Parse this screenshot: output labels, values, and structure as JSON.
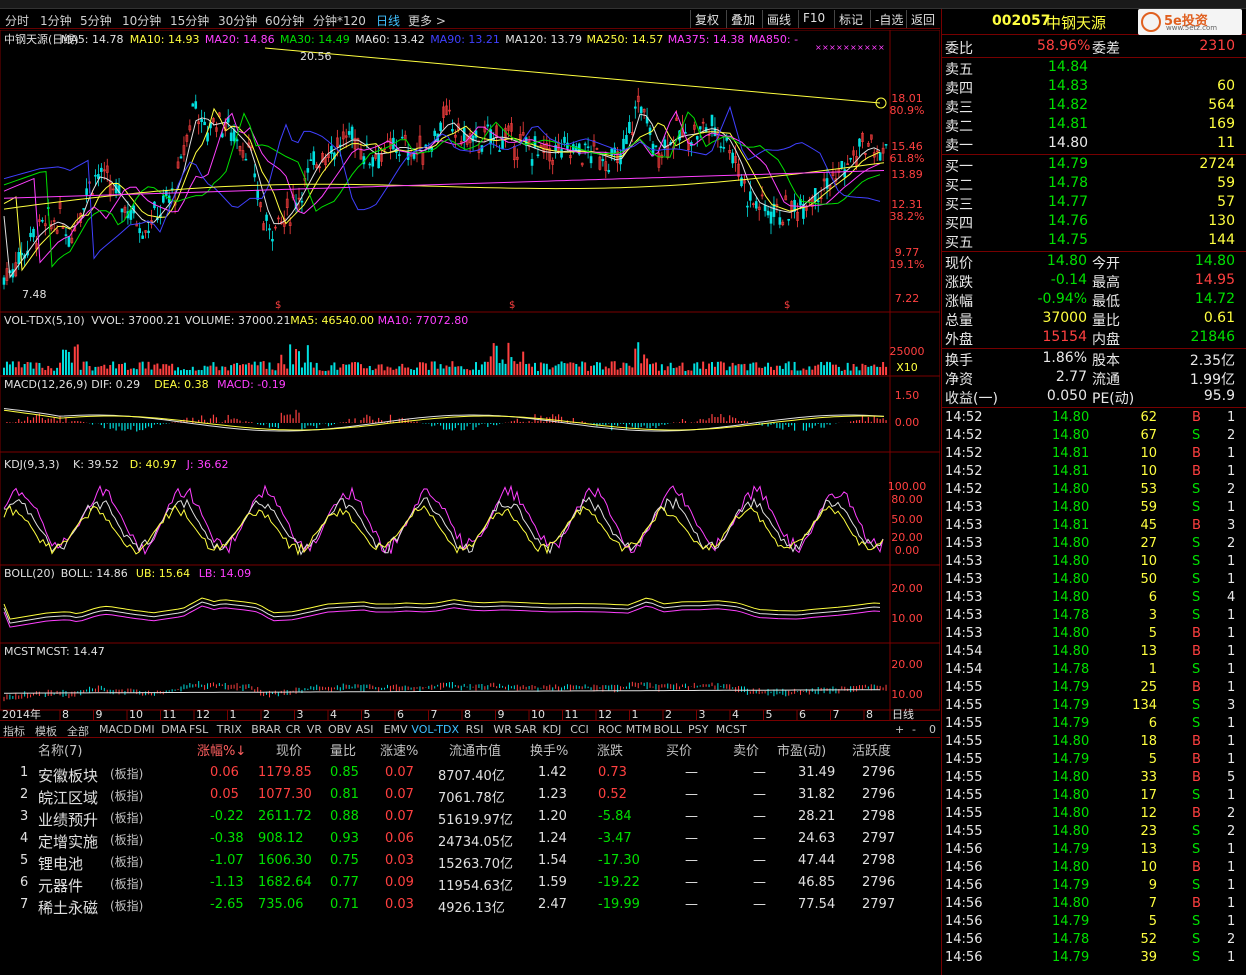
{
  "periods": [
    "分时",
    "1分钟",
    "5分钟",
    "10分钟",
    "15分钟",
    "30分钟",
    "60分钟",
    "分钟*120",
    "日线",
    "更多 >"
  ],
  "tools": [
    "复权",
    "叠加",
    "画线",
    "F10",
    "标记",
    "-自选",
    "返回"
  ],
  "stock": {
    "code": "002057",
    "name": "中钢天源",
    "logo": "5e投资",
    "logo_sub": "www.5etz.com"
  },
  "ma_legend": [
    {
      "text": "中钢天源(日线)",
      "color": "#e0e0e0"
    },
    {
      "text": "MA5: 14.78",
      "color": "#e0e0e0"
    },
    {
      "text": "MA10: 14.93",
      "color": "#ffff40"
    },
    {
      "text": "MA20: 14.86",
      "color": "#ff40ff"
    },
    {
      "text": "MA30: 14.49",
      "color": "#00e000"
    },
    {
      "text": "MA60: 13.42",
      "color": "#e0e0e0"
    },
    {
      "text": "MA90: 13.21",
      "color": "#4040ff"
    },
    {
      "text": "MA120: 13.79",
      "color": "#e0e0e0"
    },
    {
      "text": "MA250: 14.57",
      "color": "#ffff40"
    },
    {
      "text": "MA375: 14.38",
      "color": "#ff40ff"
    },
    {
      "text": "MA850: -",
      "color": "#ff40ff"
    }
  ],
  "main_axis": [
    "18.01",
    "80.9%",
    "15.46",
    "61.8%",
    "13.89",
    "12.31",
    "38.2%",
    "9.77",
    "19.1%",
    "7.22"
  ],
  "main_annotations": {
    "high": "20.56",
    "low": "7.48"
  },
  "vol_legend": [
    {
      "text": "VOL-TDX(5,10)",
      "color": "#e0e0e0"
    },
    {
      "text": "VVOL: 37000.21",
      "color": "#e0e0e0"
    },
    {
      "text": "VOLUME: 37000.21",
      "color": "#e0e0e0"
    },
    {
      "text": "MA5: 46540.00",
      "color": "#ffff40"
    },
    {
      "text": "MA10: 77072.80",
      "color": "#ff40ff"
    }
  ],
  "vol_axis": [
    "25000",
    "X10"
  ],
  "macd_legend": [
    {
      "text": "MACD(12,26,9)",
      "color": "#e0e0e0"
    },
    {
      "text": "DIF: 0.29",
      "color": "#e0e0e0"
    },
    {
      "text": "DEA: 0.38",
      "color": "#ffff40"
    },
    {
      "text": "MACD: -0.19",
      "color": "#ff40ff"
    }
  ],
  "macd_axis": [
    "1.50",
    "0.00"
  ],
  "kdj_legend": [
    {
      "text": "KDJ(9,3,3)",
      "color": "#e0e0e0"
    },
    {
      "text": "K: 39.52",
      "color": "#e0e0e0"
    },
    {
      "text": "D: 40.97",
      "color": "#ffff40"
    },
    {
      "text": "J: 36.62",
      "color": "#ff40ff"
    }
  ],
  "kdj_axis": [
    "100.00",
    "80.00",
    "50.00",
    "20.00",
    "0.00"
  ],
  "boll_legend": [
    {
      "text": "BOLL(20)",
      "color": "#e0e0e0"
    },
    {
      "text": "BOLL: 14.86",
      "color": "#e0e0e0"
    },
    {
      "text": "UB: 15.64",
      "color": "#ffff40"
    },
    {
      "text": "LB: 14.09",
      "color": "#ff40ff"
    }
  ],
  "boll_axis": [
    "20.00",
    "10.00"
  ],
  "mcst_legend": [
    {
      "text": "MCST",
      "color": "#e0e0e0"
    },
    {
      "text": "MCST: 14.47",
      "color": "#e0e0e0"
    }
  ],
  "mcst_axis": [
    "20.00",
    "10.00"
  ],
  "date_axis": {
    "year": "2014年",
    "months": [
      "8",
      "9",
      "10",
      "11",
      "12",
      "1",
      "2",
      "3",
      "4",
      "5",
      "6",
      "7",
      "8",
      "9",
      "10",
      "11",
      "12",
      "1",
      "2",
      "3",
      "4",
      "5",
      "6",
      "7",
      "8"
    ],
    "period": "日线"
  },
  "indicator_tabs": [
    "指标",
    "模板",
    "全部",
    "MACD",
    "DMI",
    "DMA",
    "FSL",
    "TRIX",
    "BRAR",
    "CR",
    "VR",
    "OBV",
    "ASI",
    "EMV",
    "VOL-TDX",
    "RSI",
    "WR",
    "SAR",
    "KDJ",
    "CCI",
    "ROC",
    "MTM",
    "BOLL",
    "PSY",
    "MCST"
  ],
  "tab_controls": [
    "+",
    "-",
    "0"
  ],
  "table": {
    "headers": [
      "名称(7)",
      "涨幅%↓",
      "现价",
      "量比",
      "涨速%",
      "流通市值",
      "换手%",
      "涨跌",
      "买价",
      "卖价",
      "市盈(动)",
      "活跃度"
    ],
    "rows": [
      {
        "n": "1",
        "name": "安徽板块",
        "tag": "(板指)",
        "chg": "0.06",
        "price": "1179.85",
        "vr": "0.85",
        "spd": "0.07",
        "cap": "8707.40亿",
        "turn": "1.42",
        "diff": "0.73",
        "bid": "—",
        "ask": "—",
        "pe": "31.49",
        "act": "2796",
        "up": true
      },
      {
        "n": "2",
        "name": "皖江区域",
        "tag": "(板指)",
        "chg": "0.05",
        "price": "1077.30",
        "vr": "0.81",
        "spd": "0.07",
        "cap": "7061.78亿",
        "turn": "1.23",
        "diff": "0.52",
        "bid": "—",
        "ask": "—",
        "pe": "31.82",
        "act": "2796",
        "up": true
      },
      {
        "n": "3",
        "name": "业绩预升",
        "tag": "(板指)",
        "chg": "-0.22",
        "price": "2611.72",
        "vr": "0.88",
        "spd": "0.07",
        "cap": "51619.97亿",
        "turn": "1.20",
        "diff": "-5.84",
        "bid": "—",
        "ask": "—",
        "pe": "28.21",
        "act": "2798",
        "up": false
      },
      {
        "n": "4",
        "name": "定增实施",
        "tag": "(板指)",
        "chg": "-0.38",
        "price": "908.12",
        "vr": "0.93",
        "spd": "0.06",
        "cap": "24734.05亿",
        "turn": "1.24",
        "diff": "-3.47",
        "bid": "—",
        "ask": "—",
        "pe": "24.63",
        "act": "2797",
        "up": false
      },
      {
        "n": "5",
        "name": "锂电池",
        "tag": "(板指)",
        "chg": "-1.07",
        "price": "1606.30",
        "vr": "0.75",
        "spd": "0.03",
        "cap": "15263.70亿",
        "turn": "1.54",
        "diff": "-17.30",
        "bid": "—",
        "ask": "—",
        "pe": "47.44",
        "act": "2798",
        "up": false
      },
      {
        "n": "6",
        "name": "元器件",
        "tag": "(板指)",
        "chg": "-1.13",
        "price": "1682.64",
        "vr": "0.77",
        "spd": "0.09",
        "cap": "11954.63亿",
        "turn": "1.59",
        "diff": "-19.22",
        "bid": "—",
        "ask": "—",
        "pe": "46.85",
        "act": "2796",
        "up": false
      },
      {
        "n": "7",
        "name": "稀土永磁",
        "tag": "(板指)",
        "chg": "-2.65",
        "price": "735.06",
        "vr": "0.71",
        "spd": "0.03",
        "cap": "4926.13亿",
        "turn": "2.47",
        "diff": "-19.99",
        "bid": "—",
        "ask": "—",
        "pe": "77.54",
        "act": "2797",
        "up": false
      }
    ]
  },
  "quote": {
    "ratio_label": "委比",
    "ratio": "58.96%",
    "diff_label": "委差",
    "diff": "2310",
    "sells": [
      {
        "l": "卖五",
        "p": "14.84",
        "v": ""
      },
      {
        "l": "卖四",
        "p": "14.83",
        "v": "60"
      },
      {
        "l": "卖三",
        "p": "14.82",
        "v": "564"
      },
      {
        "l": "卖二",
        "p": "14.81",
        "v": "169"
      },
      {
        "l": "卖一",
        "p": "14.80",
        "v": "11"
      }
    ],
    "buys": [
      {
        "l": "买一",
        "p": "14.79",
        "v": "2724"
      },
      {
        "l": "买二",
        "p": "14.78",
        "v": "59"
      },
      {
        "l": "买三",
        "p": "14.77",
        "v": "57"
      },
      {
        "l": "买四",
        "p": "14.76",
        "v": "130"
      },
      {
        "l": "买五",
        "p": "14.75",
        "v": "144"
      }
    ],
    "stats": [
      {
        "l1": "现价",
        "v1": "14.80",
        "c1": "green",
        "l2": "今开",
        "v2": "14.80",
        "c2": "green"
      },
      {
        "l1": "涨跌",
        "v1": "-0.14",
        "c1": "green",
        "l2": "最高",
        "v2": "14.95",
        "c2": "red"
      },
      {
        "l1": "涨幅",
        "v1": "-0.94%",
        "c1": "green",
        "l2": "最低",
        "v2": "14.72",
        "c2": "green"
      },
      {
        "l1": "总量",
        "v1": "37000",
        "c1": "yellow",
        "l2": "量比",
        "v2": "0.61",
        "c2": "yellow"
      },
      {
        "l1": "外盘",
        "v1": "15154",
        "c1": "red",
        "l2": "内盘",
        "v2": "21846",
        "c2": "green"
      }
    ],
    "stats2": [
      {
        "l1": "换手",
        "v1": "1.86%",
        "l2": "股本",
        "v2": "2.35亿"
      },
      {
        "l1": "净资",
        "v1": "2.77",
        "l2": "流通",
        "v2": "1.99亿"
      },
      {
        "l1": "收益(一)",
        "v1": "0.050",
        "l2": "PE(动)",
        "v2": "95.9"
      }
    ]
  },
  "ticks": [
    {
      "t": "14:52",
      "p": "14.80",
      "v": "62",
      "d": "B",
      "n": "1"
    },
    {
      "t": "14:52",
      "p": "14.80",
      "v": "67",
      "d": "S",
      "n": "2"
    },
    {
      "t": "14:52",
      "p": "14.81",
      "v": "10",
      "d": "B",
      "n": "1"
    },
    {
      "t": "14:52",
      "p": "14.81",
      "v": "10",
      "d": "B",
      "n": "1"
    },
    {
      "t": "14:52",
      "p": "14.80",
      "v": "53",
      "d": "S",
      "n": "2"
    },
    {
      "t": "14:53",
      "p": "14.80",
      "v": "59",
      "d": "S",
      "n": "1"
    },
    {
      "t": "14:53",
      "p": "14.81",
      "v": "45",
      "d": "B",
      "n": "3"
    },
    {
      "t": "14:53",
      "p": "14.80",
      "v": "27",
      "d": "S",
      "n": "2"
    },
    {
      "t": "14:53",
      "p": "14.80",
      "v": "10",
      "d": "S",
      "n": "1"
    },
    {
      "t": "14:53",
      "p": "14.80",
      "v": "50",
      "d": "S",
      "n": "1"
    },
    {
      "t": "14:53",
      "p": "14.80",
      "v": "6",
      "d": "S",
      "n": "4"
    },
    {
      "t": "14:53",
      "p": "14.78",
      "v": "3",
      "d": "S",
      "n": "1"
    },
    {
      "t": "14:53",
      "p": "14.80",
      "v": "5",
      "d": "B",
      "n": "1"
    },
    {
      "t": "14:54",
      "p": "14.80",
      "v": "13",
      "d": "B",
      "n": "1"
    },
    {
      "t": "14:54",
      "p": "14.78",
      "v": "1",
      "d": "S",
      "n": "1"
    },
    {
      "t": "14:55",
      "p": "14.79",
      "v": "25",
      "d": "B",
      "n": "1"
    },
    {
      "t": "14:55",
      "p": "14.79",
      "v": "134",
      "d": "S",
      "n": "3"
    },
    {
      "t": "14:55",
      "p": "14.79",
      "v": "6",
      "d": "S",
      "n": "1"
    },
    {
      "t": "14:55",
      "p": "14.80",
      "v": "18",
      "d": "B",
      "n": "1"
    },
    {
      "t": "14:55",
      "p": "14.79",
      "v": "5",
      "d": "B",
      "n": "1"
    },
    {
      "t": "14:55",
      "p": "14.80",
      "v": "33",
      "d": "B",
      "n": "5"
    },
    {
      "t": "14:55",
      "p": "14.80",
      "v": "17",
      "d": "S",
      "n": "1"
    },
    {
      "t": "14:55",
      "p": "14.80",
      "v": "12",
      "d": "B",
      "n": "2"
    },
    {
      "t": "14:55",
      "p": "14.80",
      "v": "23",
      "d": "S",
      "n": "2"
    },
    {
      "t": "14:56",
      "p": "14.79",
      "v": "13",
      "d": "S",
      "n": "1"
    },
    {
      "t": "14:56",
      "p": "14.80",
      "v": "10",
      "d": "B",
      "n": "1"
    },
    {
      "t": "14:56",
      "p": "14.79",
      "v": "9",
      "d": "S",
      "n": "1"
    },
    {
      "t": "14:56",
      "p": "14.80",
      "v": "7",
      "d": "B",
      "n": "1"
    },
    {
      "t": "14:56",
      "p": "14.79",
      "v": "5",
      "d": "S",
      "n": "1"
    },
    {
      "t": "14:56",
      "p": "14.78",
      "v": "52",
      "d": "S",
      "n": "2"
    },
    {
      "t": "14:56",
      "p": "14.79",
      "v": "39",
      "d": "S",
      "n": "1"
    }
  ],
  "colors": {
    "up": "#ff4040",
    "down": "#00e000",
    "grid": "#7a0000",
    "yellow": "#ffff40",
    "magenta": "#ff40ff",
    "cyan": "#00e0e0"
  }
}
